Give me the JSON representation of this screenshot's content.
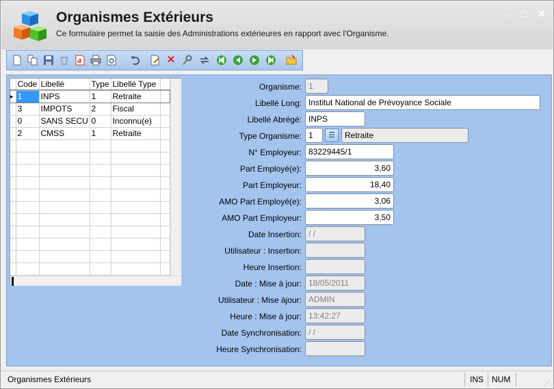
{
  "header": {
    "title": "Organismes Extérieurs",
    "subtitle": "Ce formulaire permet la saisie des Administrations extérieures en rapport avec l'Organisme.",
    "min_glyph": "_",
    "max_glyph": "□",
    "close_glyph": "✕"
  },
  "toolbar": {
    "icons": [
      "new-icon",
      "duplicate-icon",
      "save-icon",
      "delete-record-icon",
      "pdf-icon",
      "print-icon",
      "preview-icon",
      "undo-icon",
      "edit-icon",
      "cancel-icon",
      "search-icon",
      "refresh-icon",
      "first-icon",
      "previous-icon",
      "next-icon",
      "last-icon",
      "folder-icon"
    ]
  },
  "grid": {
    "columns": [
      "Code",
      "Libellé",
      "Type",
      "Libellé Type"
    ],
    "rows": [
      {
        "code": "1",
        "libelle": "INPS",
        "type": "1",
        "libelle_type": "Retraite"
      },
      {
        "code": "3",
        "libelle": "IMPOTS",
        "type": "2",
        "libelle_type": "Fiscal"
      },
      {
        "code": "0",
        "libelle": "SANS SECU",
        "type": "0",
        "libelle_type": "Inconnu(e)"
      },
      {
        "code": "2",
        "libelle": "CMSS",
        "type": "1",
        "libelle_type": "Retraite"
      }
    ],
    "selected_row": 0
  },
  "form": {
    "organisme": {
      "label": "Organisme:",
      "value": "1"
    },
    "libelle_long": {
      "label": "Libellé Long:",
      "value": "Institut National de Prévoyance Sociale"
    },
    "libelle_abrege": {
      "label": "Libellé Abrégé:",
      "value": "INPS"
    },
    "type_organisme": {
      "label": "Type Organisme:",
      "value": "1",
      "lookup": "Retraite"
    },
    "no_employeur": {
      "label": "N° Employeur:",
      "value": "83229445/1"
    },
    "part_employe": {
      "label": "Part Employé(e):",
      "value": "3,60"
    },
    "part_employeur": {
      "label": "Part Employeur:",
      "value": "18,40"
    },
    "amo_part_employe": {
      "label": "AMO Part Employé(e):",
      "value": "3,06"
    },
    "amo_part_employeur": {
      "label": "AMO Part Employeur:",
      "value": "3,50"
    },
    "date_insertion": {
      "label": "Date Insertion:",
      "value": " / /"
    },
    "utilisateur_insertion": {
      "label": "Utilisateur : Insertion:",
      "value": ""
    },
    "heure_insertion": {
      "label": "Heure Insertion:",
      "value": ""
    },
    "date_maj": {
      "label": "Date : Mise à jour:",
      "value": "18/05/2011"
    },
    "utilisateur_maj": {
      "label": "Utilisateur : Mise àjour:",
      "value": "ADMIN"
    },
    "heure_maj": {
      "label": "Heure : Mise à jour:",
      "value": "13:42:27"
    },
    "date_sync": {
      "label": "Date Synchronisation:",
      "value": " / /"
    },
    "heure_sync": {
      "label": "Heure Synchronisation:",
      "value": ""
    }
  },
  "status": {
    "text": "Organismes Extérieurs",
    "ins": "INS",
    "num": "NUM"
  }
}
